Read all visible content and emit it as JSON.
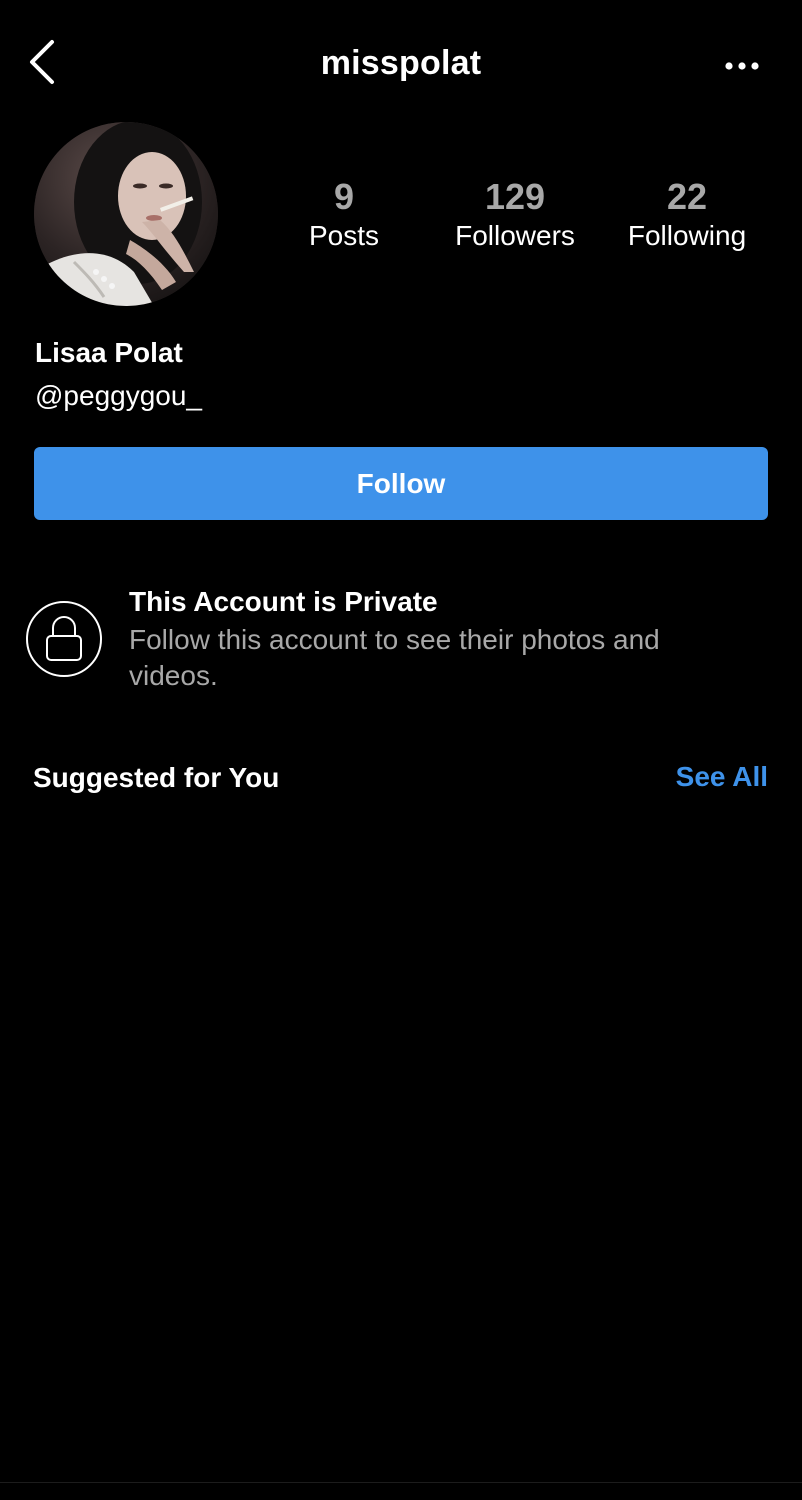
{
  "header": {
    "username": "misspolat",
    "back_icon": "chevron-left-icon",
    "more_icon": "more-horizontal-icon"
  },
  "profile": {
    "avatar_icon": "profile-photo",
    "stats": [
      {
        "count": "9",
        "label": "Posts"
      },
      {
        "count": "129",
        "label": "Followers"
      },
      {
        "count": "22",
        "label": "Following"
      }
    ],
    "full_name": "Lisaa Polat",
    "handle": "@peggygou_"
  },
  "actions": {
    "follow_label": "Follow",
    "follow_color": "#3e92ea"
  },
  "private_notice": {
    "icon": "lock-icon",
    "title": "This Account is Private",
    "description": "Follow this account to see their photos and videos."
  },
  "suggested": {
    "title": "Suggested for You",
    "see_all_label": "See All",
    "see_all_color": "#3e92ea"
  }
}
